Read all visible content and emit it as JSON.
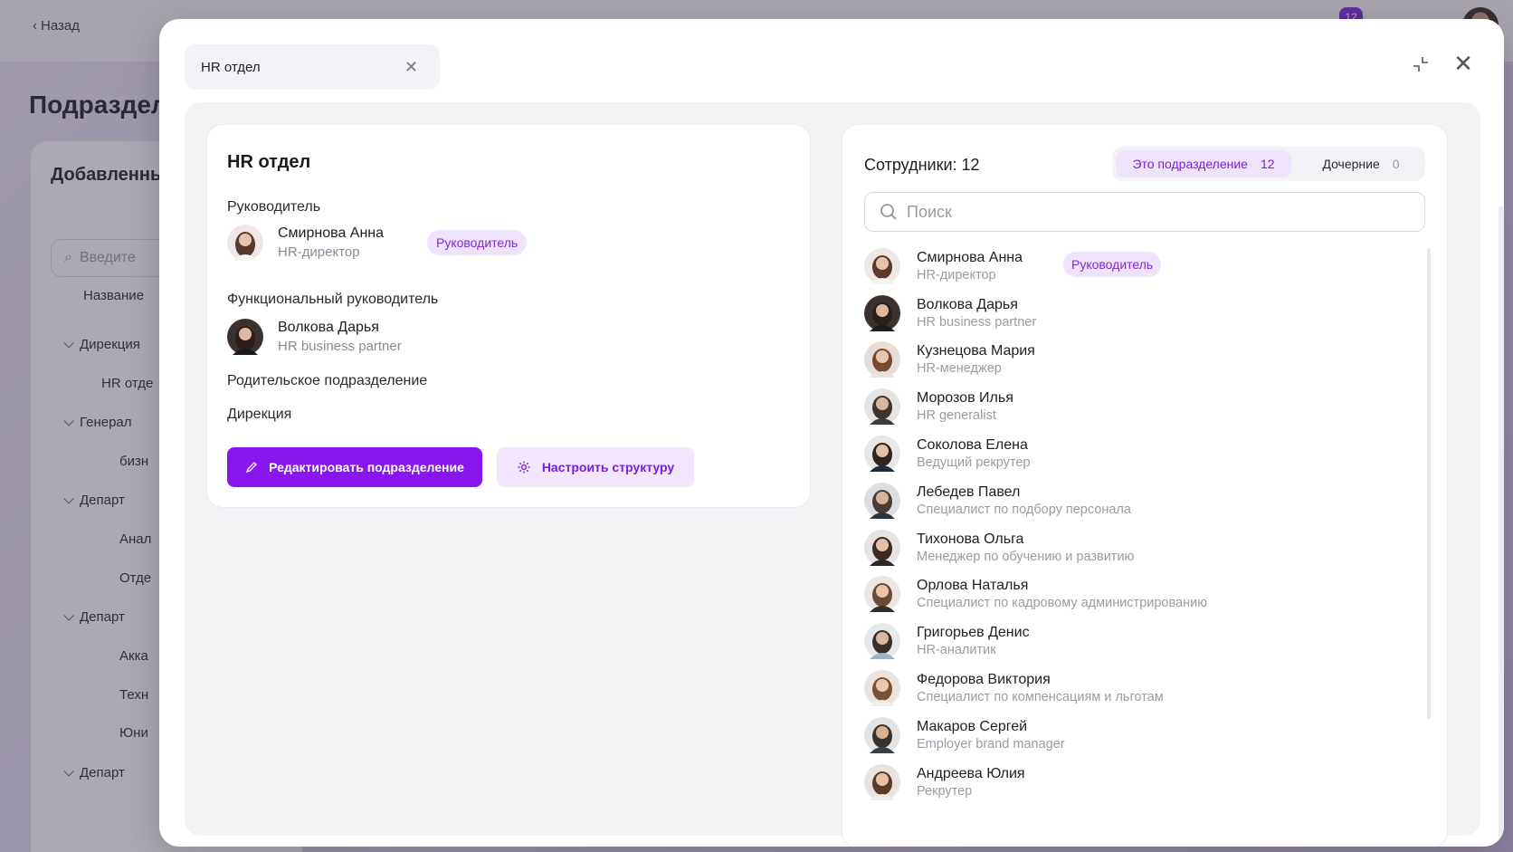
{
  "background": {
    "back_label": "Назад",
    "page_title": "Подраздел",
    "card_title": "Добавленны",
    "search_placeholder": "Введите",
    "column_header": "Название",
    "notification_count": "12",
    "tree": [
      {
        "label": "Дирекция",
        "chevron": true
      },
      {
        "label": "HR отде",
        "chevron": false
      },
      {
        "label": "Генерал",
        "chevron": true
      },
      {
        "label": "бизн",
        "chevron": false
      },
      {
        "label": "Департ",
        "chevron": true
      },
      {
        "label": "Анал",
        "chevron": false
      },
      {
        "label": "Отде",
        "chevron": false
      },
      {
        "label": "Департ",
        "chevron": true
      },
      {
        "label": "Акка",
        "chevron": false
      },
      {
        "label": "Техн",
        "chevron": false
      },
      {
        "label": "Юни",
        "chevron": false
      },
      {
        "label": "Департ",
        "chevron": true
      }
    ]
  },
  "modal": {
    "tab_label": "HR отдел",
    "unit": {
      "title": "HR отдел",
      "head_label": "Руководитель",
      "head": {
        "name": "Смирнова Анна",
        "role": "HR-директор",
        "badge": "Руководитель"
      },
      "functional_head_label": "Функциональный руководитель",
      "functional_head": {
        "name": "Волкова Дарья",
        "role": "HR business partner"
      },
      "parent_label": "Родительское подразделение",
      "parent_value": "Дирекция",
      "edit_button": "Редактировать подразделение",
      "structure_button": "Настроить структуру"
    },
    "employees": {
      "count_label": "Сотрудники: 12",
      "tab_this": {
        "label": "Это подразделение",
        "count": "12"
      },
      "tab_children": {
        "label": "Дочерние",
        "count": "0"
      },
      "search_placeholder": "Поиск",
      "lead_badge": "Руководитель",
      "list": [
        {
          "name": "Смирнова Анна",
          "role": "HR-директор",
          "badge": true
        },
        {
          "name": "Волкова Дарья",
          "role": "HR business partner"
        },
        {
          "name": "Кузнецова Мария",
          "role": "HR-менеджер"
        },
        {
          "name": "Морозов Илья",
          "role": "HR generalist"
        },
        {
          "name": "Соколова Елена",
          "role": "Ведущий рекрутер"
        },
        {
          "name": "Лебедев Павел",
          "role": "Специалист по подбору персонала"
        },
        {
          "name": "Тихонова Ольга",
          "role": "Менеджер по обучению и развитию"
        },
        {
          "name": "Орлова Наталья",
          "role": "Специалист по кадровому администрированию"
        },
        {
          "name": "Григорьев Денис",
          "role": "HR-аналитик"
        },
        {
          "name": "Федорова Виктория",
          "role": "Специалист по компенсациям и льготам"
        },
        {
          "name": "Макаров Сергей",
          "role": "Employer brand manager"
        },
        {
          "name": "Андреева Юлия",
          "role": "Рекрутер"
        }
      ]
    }
  },
  "colors": {
    "accent": "#8a16ee",
    "accent_soft": "#efe3fb"
  }
}
